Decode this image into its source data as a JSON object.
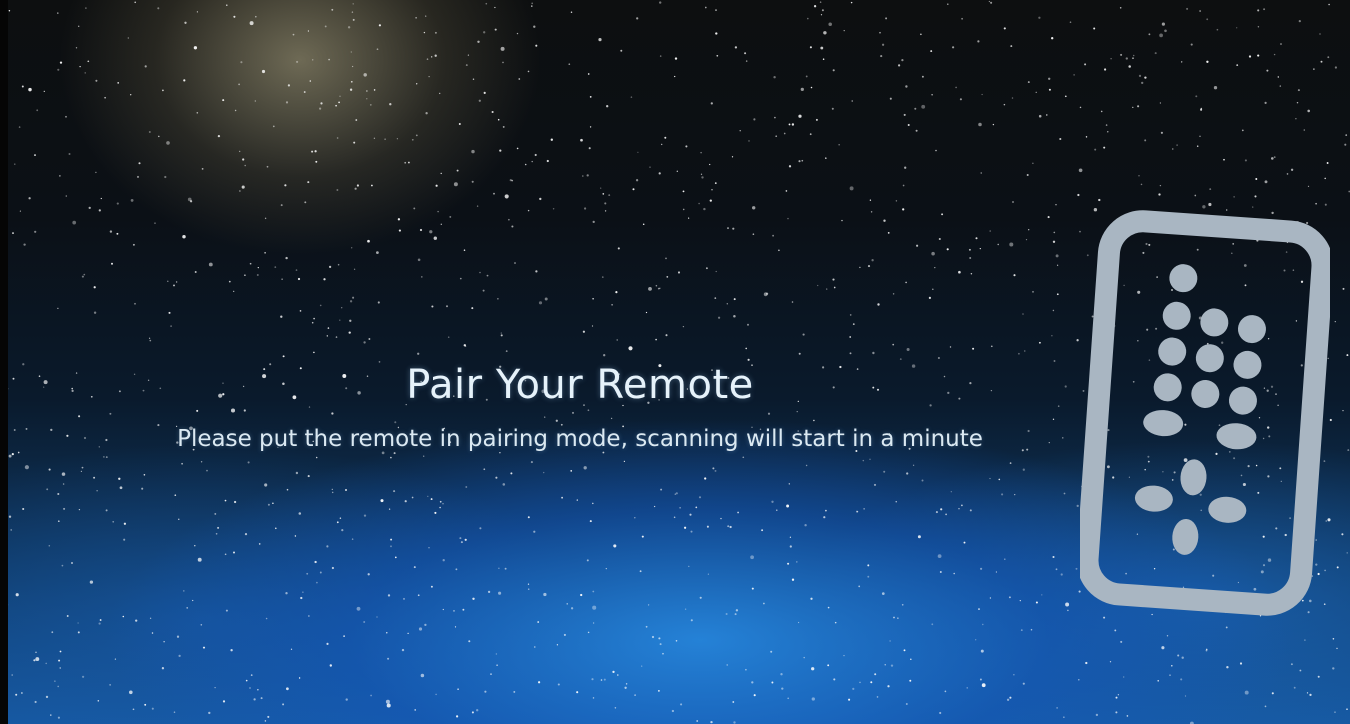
{
  "dialog": {
    "title": "Pair Your Remote",
    "message": "Please put the remote in pairing mode, scanning will start in a minute"
  },
  "icon": {
    "name": "remote-control-icon",
    "color": "#a9b6c2"
  },
  "theme": {
    "background": "starfield-night-sky",
    "text_color": "#e6f2fa"
  }
}
